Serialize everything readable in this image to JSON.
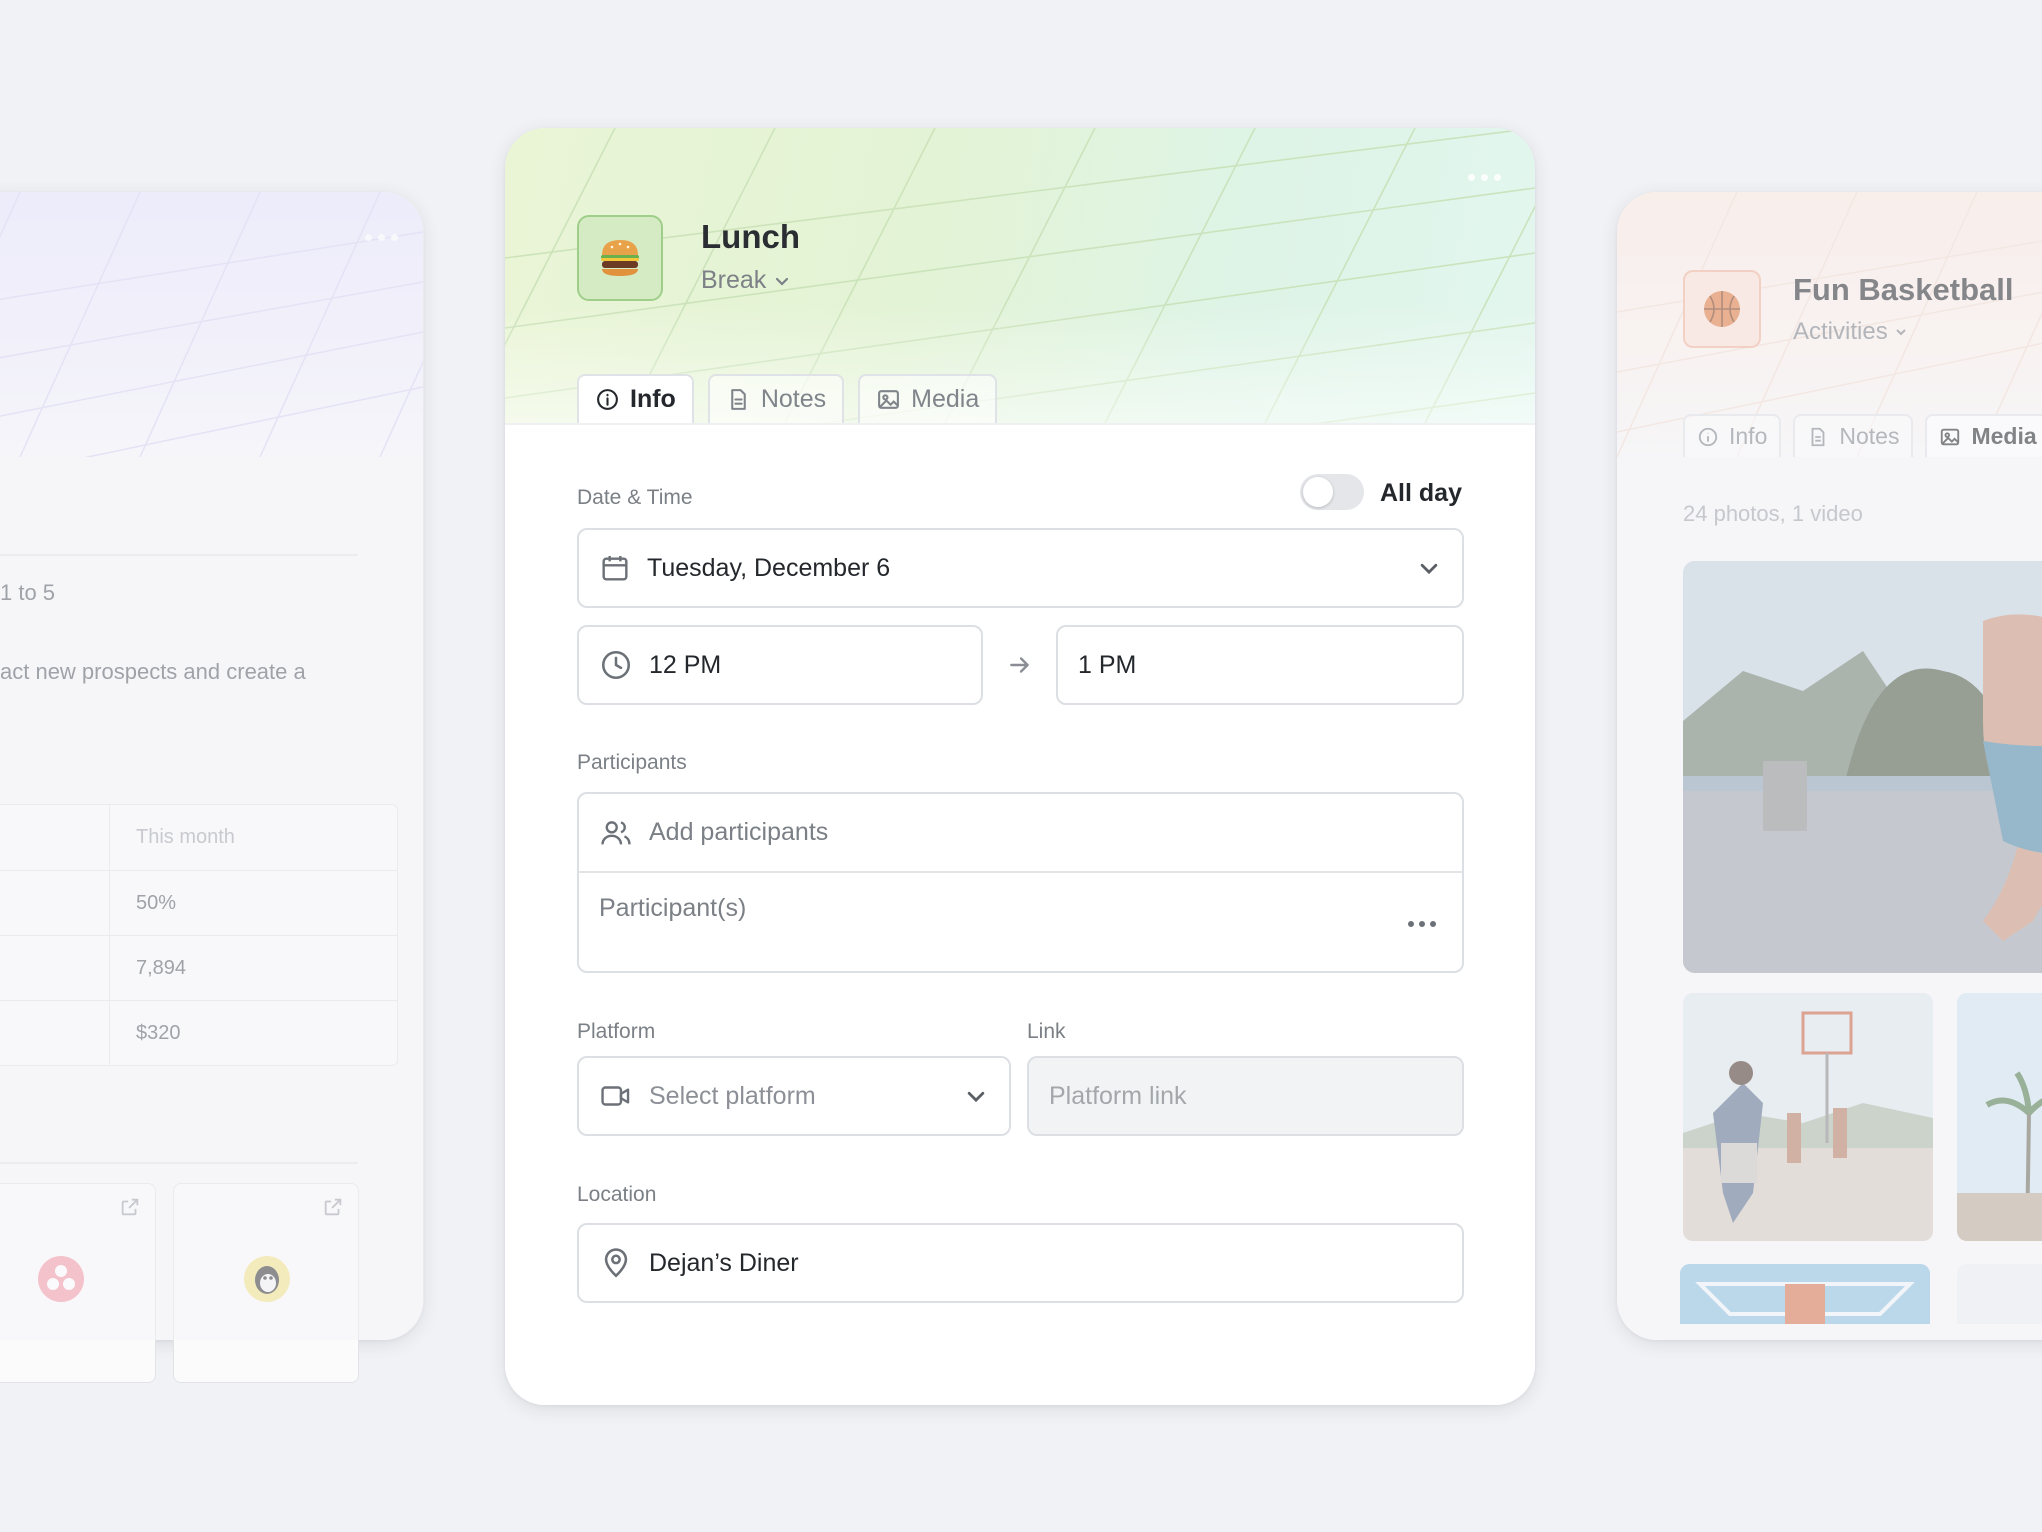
{
  "left_card": {
    "range_text": "1 to 5",
    "description_text": "act new prospects and create a",
    "table": {
      "header": "This month",
      "values": [
        "50%",
        "7,894",
        "$320"
      ]
    }
  },
  "main_card": {
    "title": "Lunch",
    "category": "Break",
    "emoji": "🍔",
    "tabs": [
      {
        "label": "Info"
      },
      {
        "label": "Notes"
      },
      {
        "label": "Media"
      }
    ],
    "date_time": {
      "label": "Date & Time",
      "all_day_label": "All day",
      "all_day_on": false,
      "date": "Tuesday, December 6",
      "start": "12 PM",
      "end": "1 PM"
    },
    "participants": {
      "label": "Participants",
      "add_placeholder": "Add participants",
      "list_placeholder": "Participant(s)"
    },
    "platform": {
      "label": "Platform",
      "placeholder": "Select platform"
    },
    "link": {
      "label": "Link",
      "placeholder": "Platform link"
    },
    "location": {
      "label": "Location",
      "value": "Dejan’s Diner"
    }
  },
  "right_card": {
    "title": "Fun Basketball",
    "category": "Activities",
    "tabs": [
      {
        "label": "Info"
      },
      {
        "label": "Notes"
      },
      {
        "label": "Media"
      }
    ],
    "media_count": "24 photos, 1 video"
  }
}
